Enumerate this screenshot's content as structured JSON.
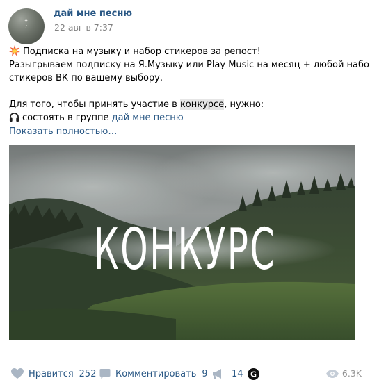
{
  "post": {
    "author": "дай мне песню",
    "date": "22 авг в 7:37",
    "avatar_icon": "music-group-avatar"
  },
  "text": {
    "line1": "Подписка на музыку и набор стикеров за репост!",
    "line2": "Разыгрываем подписку на Я.Музыку или Play Music на месяц + любой набор",
    "line3": "стикеров ВК по вашему выбору.",
    "line5_before": "Для того, чтобы принять участие в ",
    "line5_highlight": "конкурсе",
    "line5_after": ", нужно:",
    "line6_before": "состоять в группе ",
    "line6_link": "дай мне песню",
    "show_more": "Показать полностью…",
    "emoji1": "collision-icon",
    "emoji2": "headphones-icon"
  },
  "image": {
    "overlay_text": "КОНКУРС"
  },
  "footer": {
    "like_label": "Нравится",
    "like_count": "252",
    "comment_label": "Комментировать",
    "comment_count": "9",
    "share_count": "14",
    "views": "6.3K"
  },
  "colors": {
    "link": "#2a5885",
    "meta": "#828282",
    "icon": "#aab6c4"
  }
}
